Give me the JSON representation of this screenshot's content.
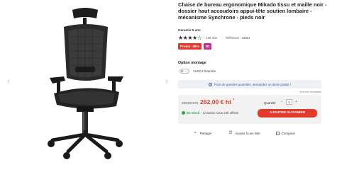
{
  "gallery": {
    "prev_arrow": "‹",
    "next_arrow": "›",
    "image_label": "chair-image"
  },
  "product": {
    "title": "Chaise de bureau ergonomique Mikado tissu et maille noir - dossier haut accoudoirs appui-tête soutien lombaire - mécanisme Synchrone - pieds noir",
    "guarantee": "Garantie 5 ans",
    "stars": "★★★★☆",
    "reviews": "149 avis",
    "reference": "Référence : 32851",
    "badges": {
      "promo": "Promo -36%",
      "threed": "3D"
    }
  },
  "option": {
    "title": "Option montage",
    "label": "19,00 € ht/article"
  },
  "banner": {
    "icon": "i",
    "text": "Pour de grandes quantités, demandez un devis gratuit !"
  },
  "stock_note": "*prix non remisable",
  "buy": {
    "old_price": "408,00 € ht",
    "new_price": "262,00 € ht",
    "new_price_mark": "*",
    "qty_label": "Quantité",
    "qty_minus": "–",
    "qty_value": "1",
    "qty_plus": "+",
    "in_stock": "En stock",
    "delivery": "- Livraison sous 24h offerte",
    "add_to_cart": "AJOUTER AU PANIER"
  },
  "actions": {
    "share": "Partager",
    "add_list": "Ajouter à une liste",
    "compare": "Comparer"
  },
  "colors": {
    "accent": "#e23b2e",
    "badge_3d": "#c2328a",
    "stock_green": "#2ea44f",
    "banner_text": "#3a5a9a"
  }
}
